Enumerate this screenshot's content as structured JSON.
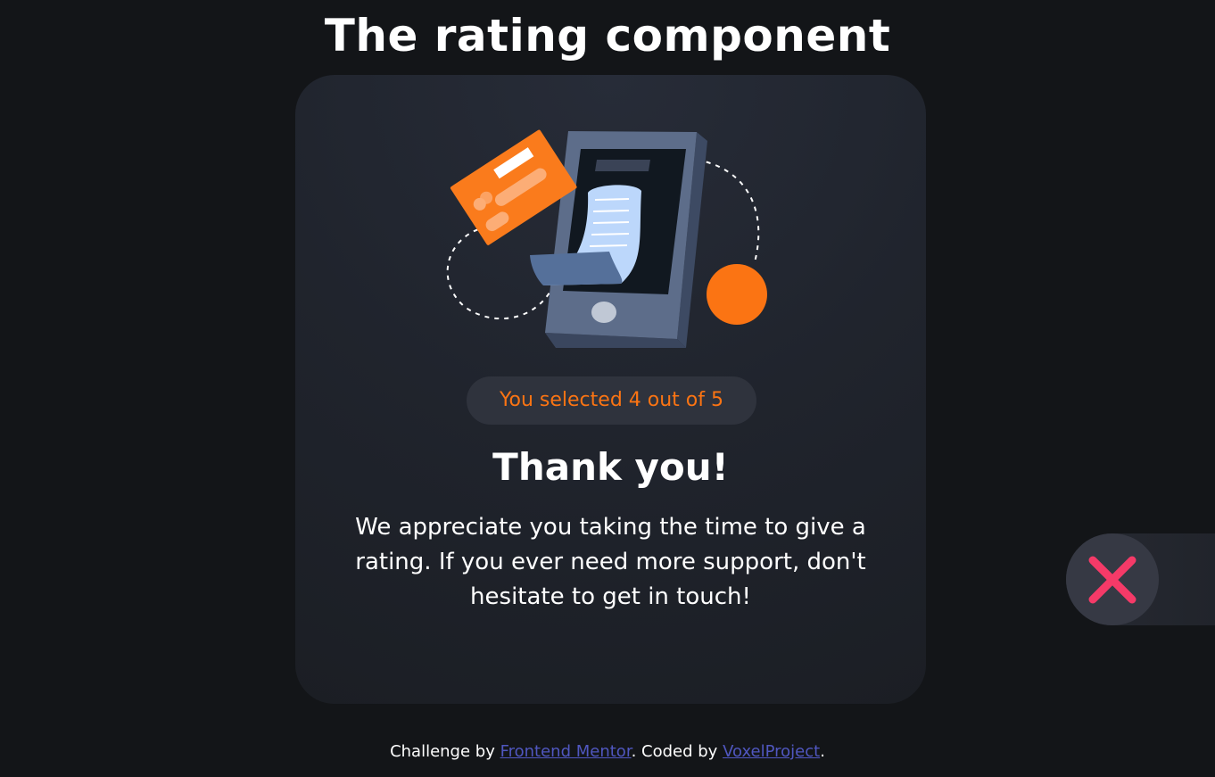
{
  "page": {
    "title": "The rating component"
  },
  "card": {
    "rating_text": "You selected 4 out of 5",
    "selected_rating": 4,
    "max_rating": 5,
    "heading": "Thank you!",
    "message": "We appreciate you taking the time to give a rating. If you ever need more support, don't hesitate to get in touch!"
  },
  "close_control": {
    "icon": "close-icon",
    "color": "#f53a68"
  },
  "footer": {
    "prefix": "Challenge by ",
    "link1": "Frontend Mentor",
    "middle": ". Coded by ",
    "link2": "VoxelProject",
    "suffix": "."
  },
  "colors": {
    "background": "#131518",
    "card": "#232731",
    "accent_orange": "#fb7413",
    "link": "#5057c0"
  }
}
